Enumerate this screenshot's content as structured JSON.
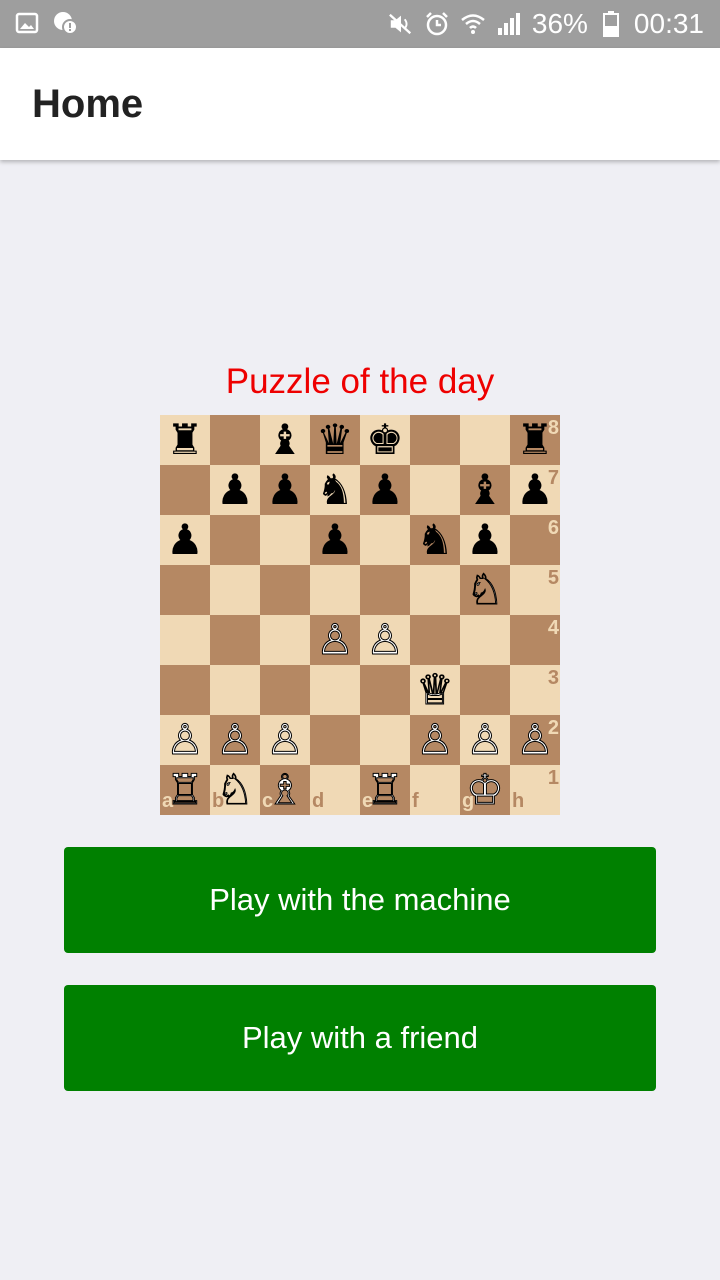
{
  "status_bar": {
    "battery": "36%",
    "time": "00:31",
    "left_icons": [
      "image-notification-icon",
      "chat-notification-icon"
    ],
    "right_icons": [
      "mute-icon",
      "alarm-icon",
      "wifi-icon",
      "signal-icon",
      "battery-icon"
    ]
  },
  "app_bar": {
    "title": "Home"
  },
  "puzzle": {
    "title": "Puzzle of the day",
    "board": [
      [
        "r",
        "",
        "b",
        "q",
        "k",
        "",
        "",
        "r"
      ],
      [
        "",
        "p",
        "p",
        "n",
        "p",
        "",
        "b",
        "p"
      ],
      [
        "p",
        "",
        "",
        "p",
        "",
        "n",
        "p",
        ""
      ],
      [
        "",
        "",
        "",
        "",
        "",
        "",
        "N",
        ""
      ],
      [
        "",
        "",
        "",
        "P",
        "P",
        "",
        "",
        ""
      ],
      [
        "",
        "",
        "",
        "",
        "",
        "Q",
        "",
        ""
      ],
      [
        "P",
        "P",
        "P",
        "",
        "",
        "P",
        "P",
        "P"
      ],
      [
        "R",
        "N",
        "B",
        "",
        "R",
        "",
        "K",
        ""
      ]
    ],
    "ranks": [
      "8",
      "7",
      "6",
      "5",
      "4",
      "3",
      "2",
      "1"
    ],
    "files": [
      "a",
      "b",
      "c",
      "d",
      "e",
      "f",
      "g",
      "h"
    ],
    "colors": {
      "light": "#f0d9b5",
      "dark": "#b58863"
    }
  },
  "buttons": {
    "machine": "Play with the machine",
    "friend": "Play with a friend"
  },
  "colors": {
    "accent_green": "#008000",
    "puzzle_title": "#ee0000",
    "status_bar": "#9e9e9e",
    "background": "#efeff4"
  }
}
